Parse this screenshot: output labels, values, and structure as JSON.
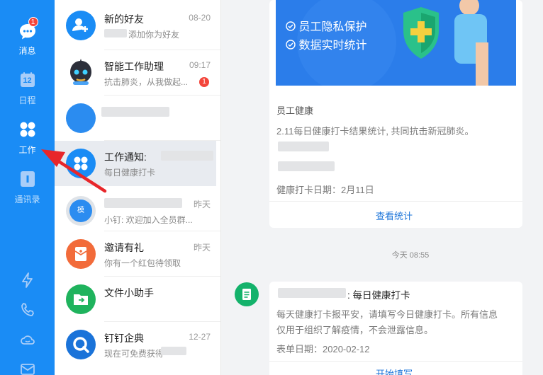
{
  "nav": {
    "items": [
      {
        "label": "消息",
        "badge": "1",
        "icon": "message-bubble-icon"
      },
      {
        "label": "日程",
        "icon_text": "12",
        "icon": "calendar-icon"
      },
      {
        "label": "工作",
        "icon": "work-grid-icon"
      },
      {
        "label": "通讯录",
        "icon": "contacts-icon"
      }
    ],
    "bottom_icons": [
      "lightning-icon",
      "phone-icon",
      "cloud-icon",
      "mail-icon"
    ]
  },
  "conversations": [
    {
      "name": "新的好友",
      "time": "08-20",
      "preview": "添加你为好友",
      "icon": "add-friend-icon",
      "color": "#1a8cf5"
    },
    {
      "name": "智能工作助理",
      "time": "09:17",
      "preview": "抗击肺炎，从我做起...",
      "unread": "1",
      "icon": "robot-icon"
    },
    {
      "name": "",
      "time": "",
      "preview": "",
      "icon": "group-icon",
      "color": "#2b8cf0"
    },
    {
      "name": "工作通知:",
      "time": "",
      "preview": "每日健康打卡",
      "icon": "work-grid-icon",
      "color": "#1a8cf5"
    },
    {
      "name": "",
      "time": "昨天",
      "preview": "小钉: 欢迎加入全员群...",
      "icon": "team-icon",
      "color": "#9aa3ad",
      "avatar_text": "模"
    },
    {
      "name": "邀请有礼",
      "time": "昨天",
      "preview": "你有一个红包待领取",
      "icon": "red-packet-icon",
      "color": "#f26b3a"
    },
    {
      "name": "文件小助手",
      "time": "",
      "preview": "",
      "icon": "folder-icon",
      "color": "#1fb35d"
    },
    {
      "name": "钉钉企典",
      "time": "12-27",
      "preview": "现在可免费获得",
      "icon": "search-icon",
      "color": "#1a73d9"
    }
  ],
  "card1": {
    "banner_features": [
      "员工隐私保护",
      "数据实时统计"
    ],
    "title": "员工健康",
    "desc": "2.11每日健康打卡结果统计, 共同抗击新冠肺炎。",
    "date_line": "健康打卡日期：2月11日",
    "link": "查看统计"
  },
  "time_divider": "今天 08:55",
  "card2": {
    "title_suffix": ": 每日健康打卡",
    "desc_line1": "每天健康打卡报平安，请填写今日健康打卡。所有信息",
    "desc_line2": "仅用于组织了解疫情，不会泄露信息。",
    "date_line": "表单日期：2020-02-12",
    "link": "开始填写"
  },
  "colors": {
    "nav_bg": "#1a8cf5",
    "link": "#1a73d9",
    "badge": "#f3453b",
    "annotation_arrow": "#e8262a"
  }
}
